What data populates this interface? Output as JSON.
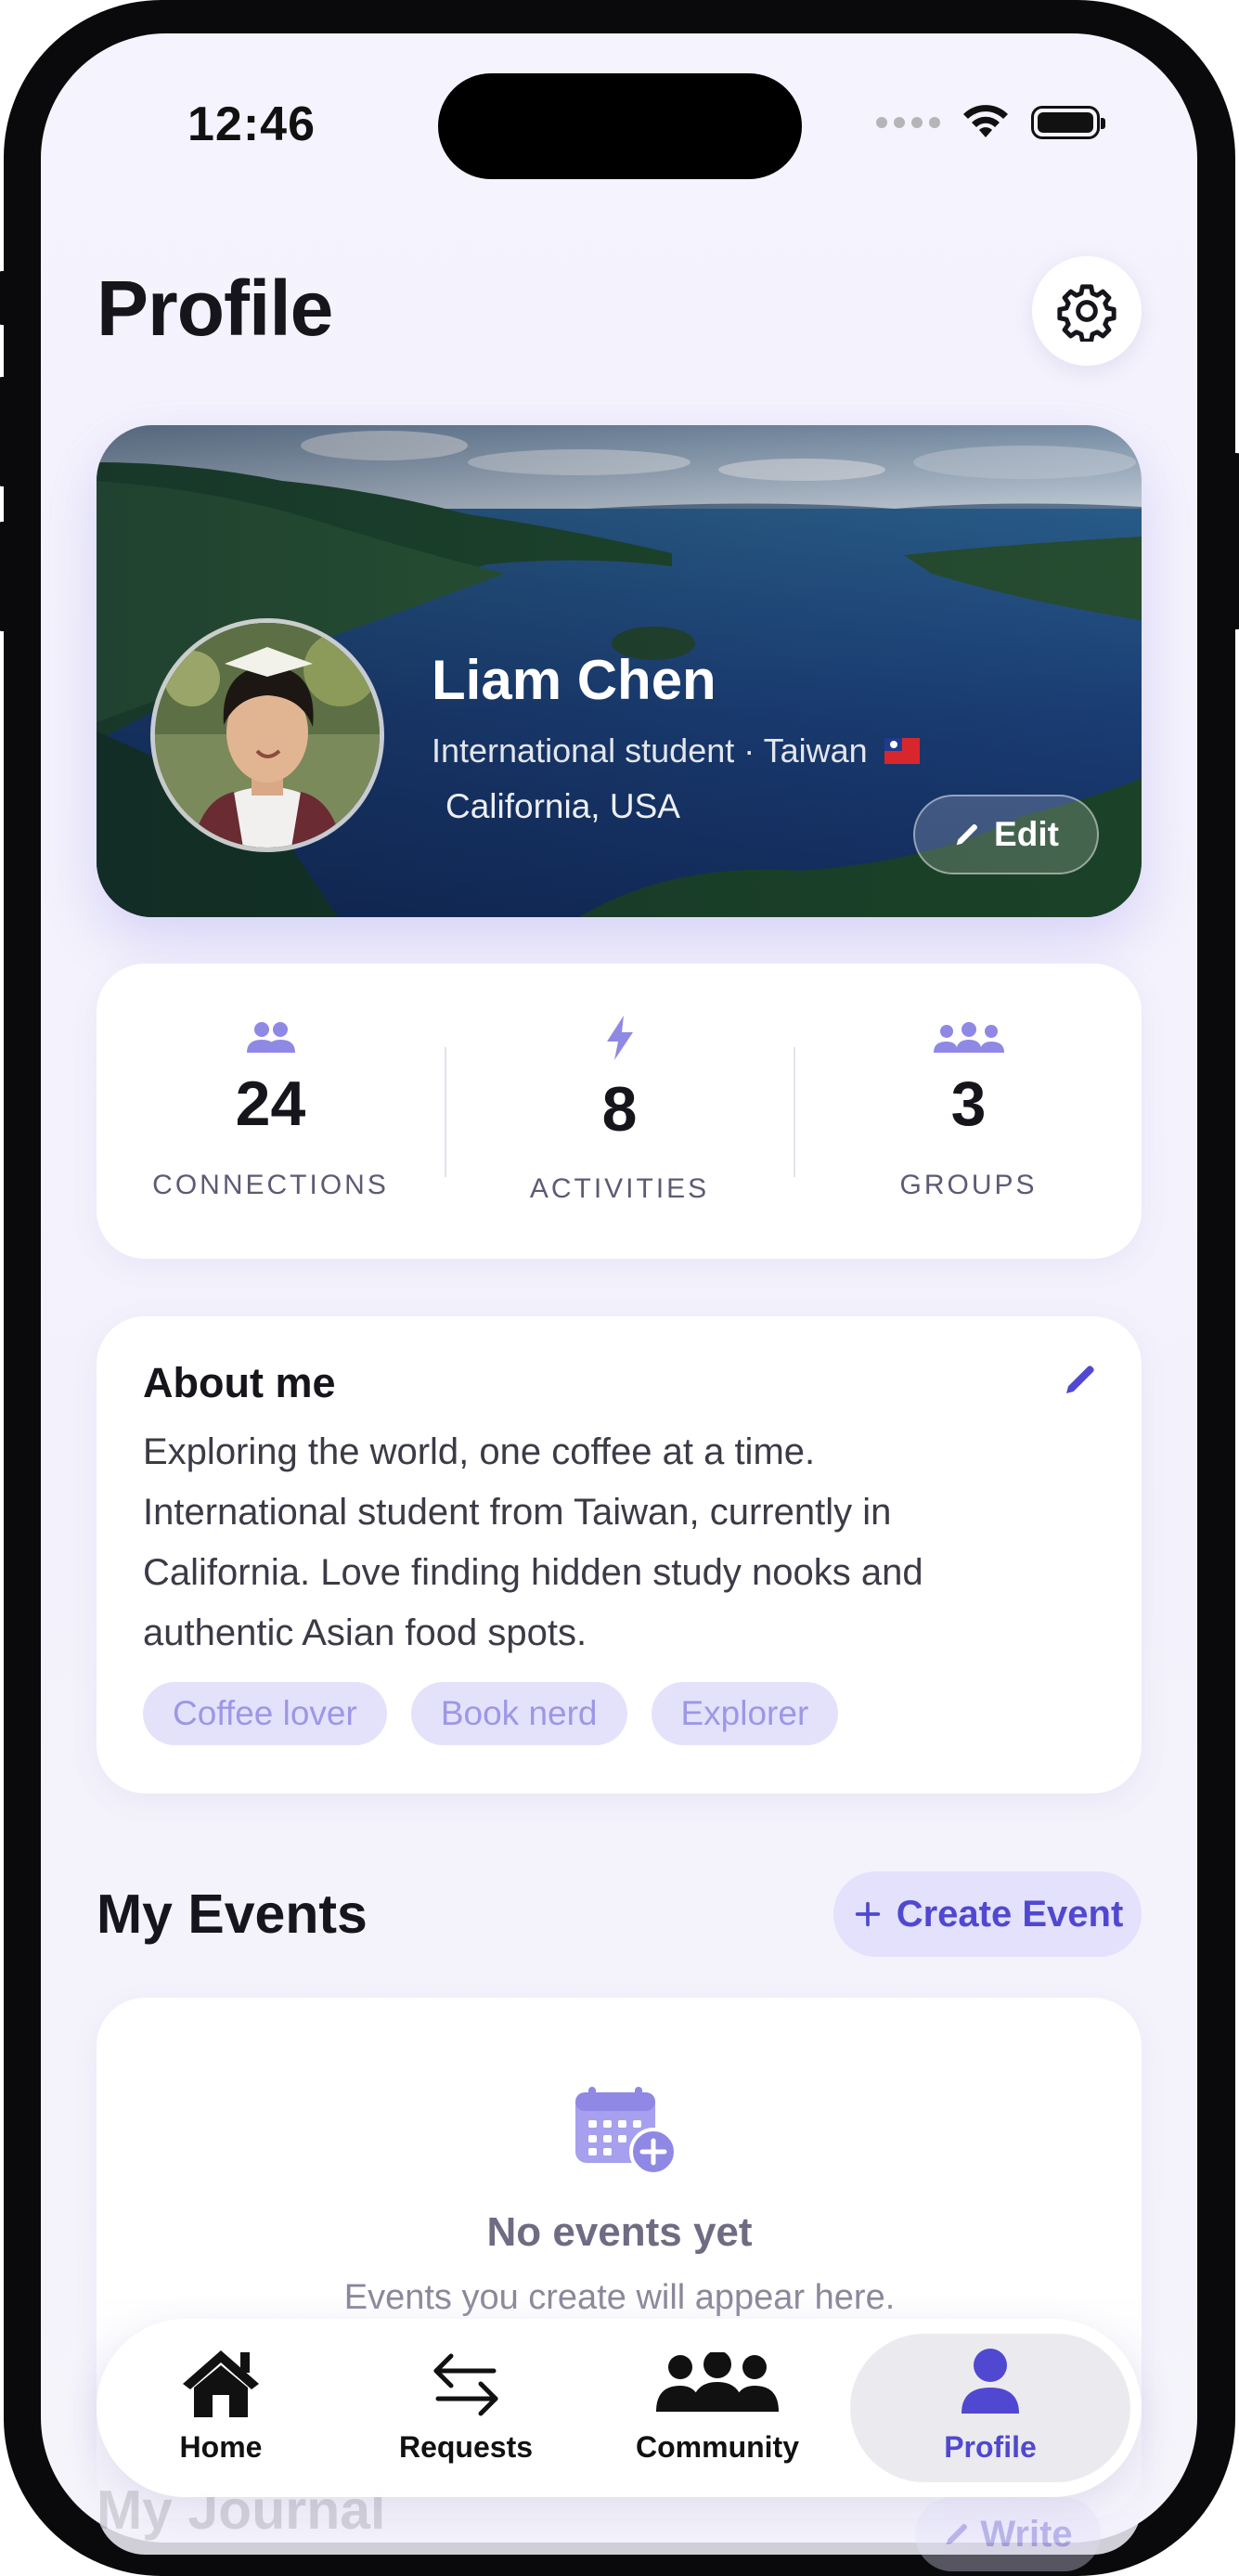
{
  "status_bar": {
    "time": "12:46"
  },
  "header": {
    "title": "Profile"
  },
  "profile": {
    "name": "Liam Chen",
    "subtitle": "International student · Taiwan",
    "location": "California, USA",
    "edit_label": "Edit"
  },
  "stats": [
    {
      "value": "24",
      "label": "CONNECTIONS"
    },
    {
      "value": "8",
      "label": "ACTIVITIES"
    },
    {
      "value": "3",
      "label": "GROUPS"
    }
  ],
  "about": {
    "title": "About me",
    "lines": [
      "Exploring the world, one coffee at a time.",
      "International student from Taiwan, currently in",
      "California. Love finding hidden study nooks and",
      "authentic Asian food spots."
    ],
    "tags": [
      "Coffee lover",
      "Book nerd",
      "Explorer"
    ]
  },
  "events": {
    "title": "My Events",
    "create_label": "Create Event",
    "empty_title": "No events yet",
    "empty_subtitle": "Events you create will appear here."
  },
  "journal": {
    "title": "My Journal",
    "write_label": "Write"
  },
  "tabbar": {
    "items": [
      {
        "label": "Home",
        "icon": "home-icon"
      },
      {
        "label": "Requests",
        "icon": "arrows-icon"
      },
      {
        "label": "Community",
        "icon": "people-icon"
      },
      {
        "label": "Profile",
        "icon": "person-icon"
      }
    ],
    "active": "Profile"
  },
  "colors": {
    "accent": "#5048d0",
    "accent_soft": "#e3e1fb",
    "stat_icon": "#8f88e4"
  }
}
